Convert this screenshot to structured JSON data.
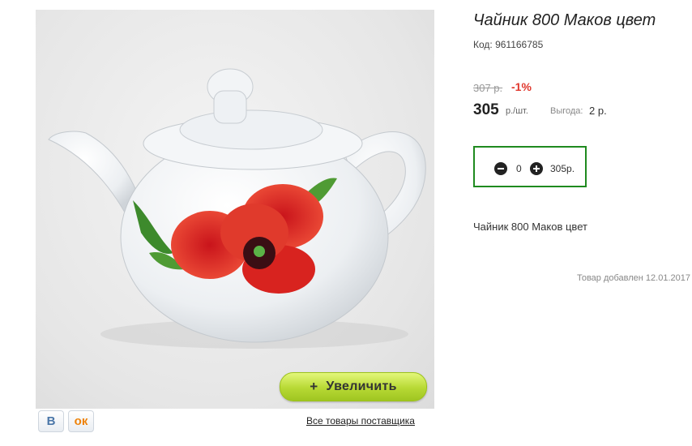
{
  "product": {
    "title": "Чайник 800 Маков цвет",
    "code_label": "Код: 961166785",
    "old_price": "307 р.",
    "discount": "-1%",
    "price": "305",
    "price_unit": "р./шт.",
    "benefit_label": "Выгода:",
    "benefit_value": "2 р.",
    "description": "Чайник 800 Маков цвет",
    "added_date": "Товар добавлен 12.01.2017"
  },
  "quantity": {
    "value": "0",
    "total": "305р."
  },
  "image": {
    "zoom_label": "Увеличить",
    "zoom_icon": "+"
  },
  "social": {
    "vk_label": "В",
    "ok_label": "ок"
  },
  "supplier_link": "Все товары поставщика",
  "colors": {
    "discount": "#e0362c",
    "quantity_border": "#1f8a1f",
    "zoom_button": "#b7d934"
  }
}
